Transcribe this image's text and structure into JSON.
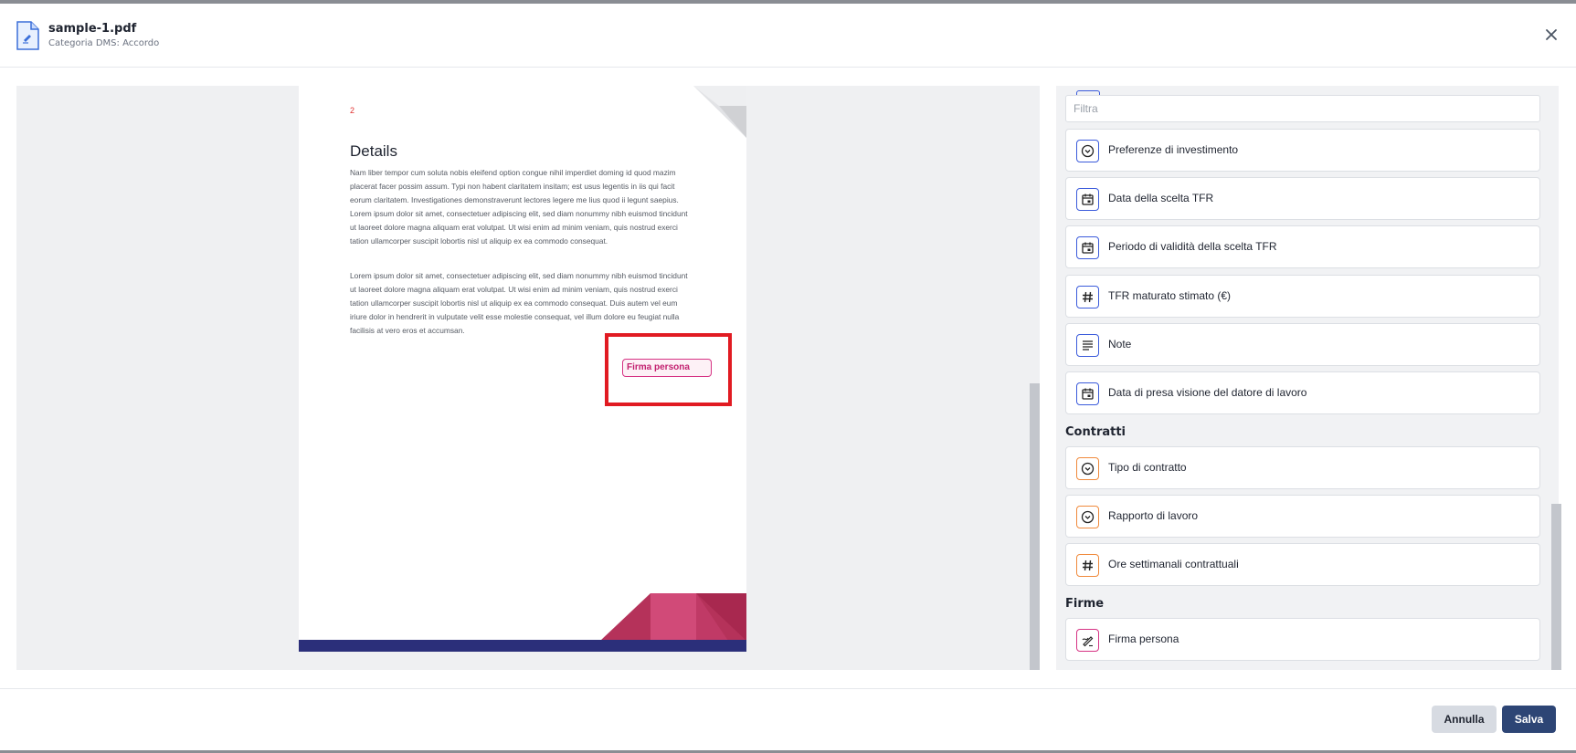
{
  "header": {
    "file_name": "sample-1.pdf",
    "category": "Categoria DMS: Accordo"
  },
  "document": {
    "page_number": "2",
    "title": "Details",
    "paragraph1": "Nam liber tempor cum soluta nobis eleifend option congue nihil imperdiet doming id quod mazim placerat facer possim assum. Typi non habent claritatem insitam; est usus legentis in iis qui facit eorum claritatem. Investigationes demonstraverunt lectores legere me lius quod ii legunt saepius. Lorem ipsum dolor sit amet, consectetuer adipiscing elit, sed diam nonummy nibh euismod tincidunt ut laoreet dolore magna aliquam erat volutpat. Ut wisi enim ad minim veniam, quis nostrud exerci tation ullamcorper suscipit lobortis nisl ut aliquip ex ea commodo consequat.",
    "paragraph2": "Lorem ipsum dolor sit amet, consectetuer adipiscing elit, sed diam nonummy nibh euismod tincidunt ut laoreet dolore magna aliquam erat volutpat. Ut wisi enim ad minim veniam, quis nostrud exerci tation ullamcorper suscipit lobortis nisl ut aliquip ex ea commodo consequat. Duis autem vel eum iriure dolor in hendrerit in vulputate velit esse molestie consequat, vel illum dolore eu feugiat nulla facilisis at vero eros et accumsan.",
    "signature_field": "Firma persona"
  },
  "panel": {
    "filter_placeholder": "Filtra",
    "filter_value": "",
    "items_top": [
      {
        "label": "Preferenze di investimento",
        "icon": "dropdown-icon"
      },
      {
        "label": "Data della scelta TFR",
        "icon": "calendar-icon"
      },
      {
        "label": "Periodo di validità della scelta TFR",
        "icon": "calendar-icon"
      },
      {
        "label": "TFR maturato stimato (€)",
        "icon": "hash-icon"
      },
      {
        "label": "Note",
        "icon": "text-icon"
      },
      {
        "label": "Data di presa visione del datore di lavoro",
        "icon": "calendar-icon"
      }
    ],
    "section_contratti": "Contratti",
    "items_contratti": [
      {
        "label": "Tipo di contratto",
        "icon": "dropdown-icon"
      },
      {
        "label": "Rapporto di lavoro",
        "icon": "dropdown-icon"
      },
      {
        "label": "Ore settimanali contrattuali",
        "icon": "hash-icon"
      }
    ],
    "section_firme": "Firme",
    "items_firme": [
      {
        "label": "Firma persona",
        "icon": "signature-icon"
      }
    ]
  },
  "footer": {
    "cancel_label": "Annulla",
    "save_label": "Salva"
  },
  "colors": {
    "accent_blue": "#3b5bdb",
    "accent_orange": "#f08a3c",
    "accent_pink": "#d63384",
    "highlight_red": "#e11b22",
    "save_button": "#2d4575"
  }
}
